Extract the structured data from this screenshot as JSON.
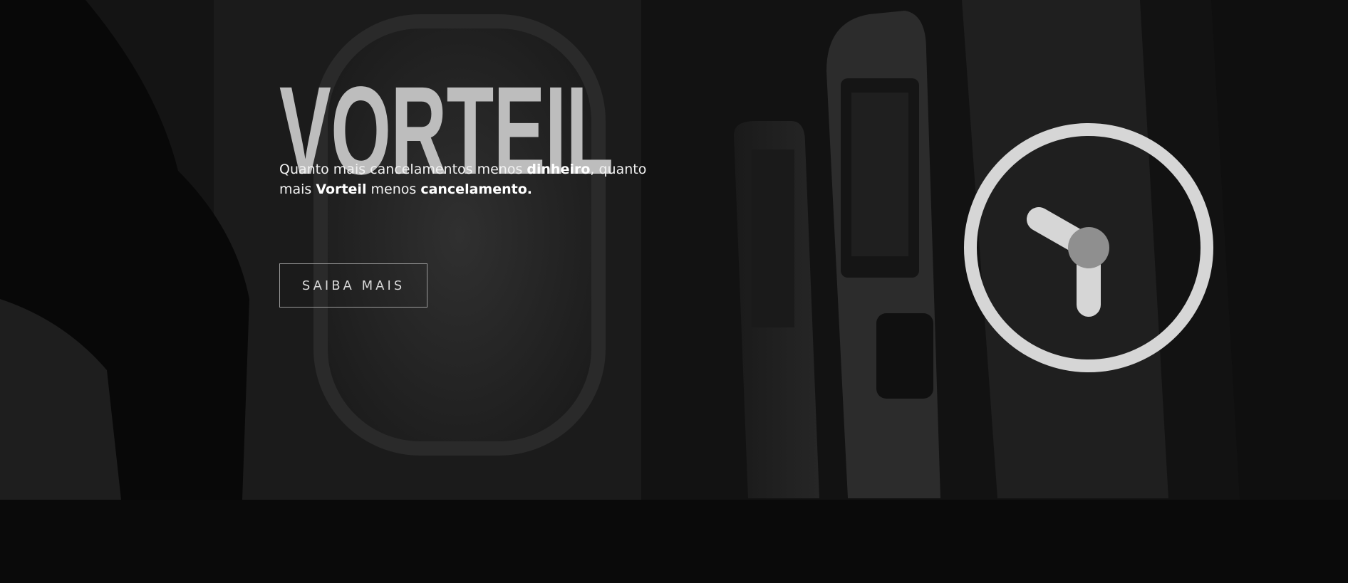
{
  "hero": {
    "title": "VORTEIL",
    "tagline": {
      "part1": "Quanto mais cancelamentos menos ",
      "bold1": "dinheiro",
      "part2": ", quanto mais ",
      "bold2": "Vorteil",
      "part3": " menos ",
      "bold3": "cancelamento."
    },
    "cta_label": "SAIBA MAIS",
    "clock_icon": "clock-icon"
  },
  "colors": {
    "title": "#bdbdbd",
    "text": "#f2f2f2",
    "button_border": "#9a9a9a",
    "clock_ring": "#d6d6d6",
    "clock_center": "#8f8f8f",
    "page_bg": "#0a0a0a"
  }
}
